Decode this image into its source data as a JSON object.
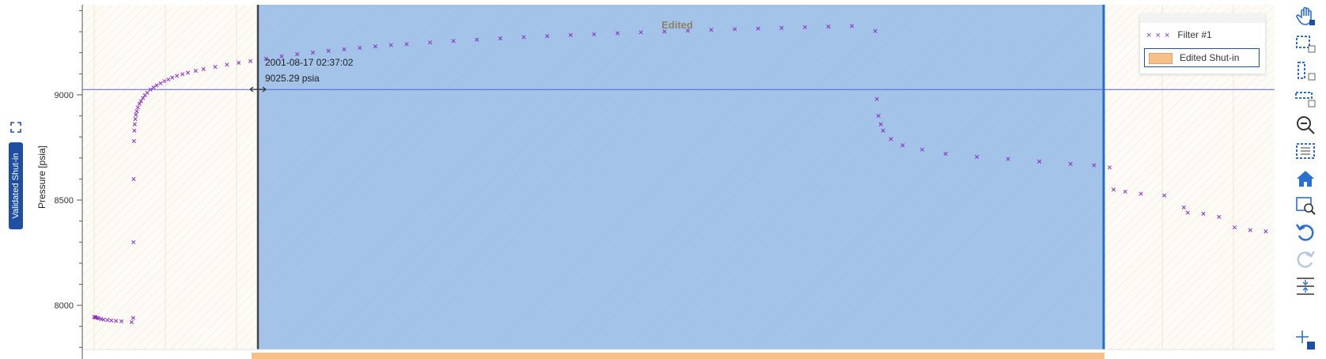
{
  "side_tab": {
    "label": "Validated Shut-in"
  },
  "legend": {
    "filter_label": "Filter #1",
    "shutin_label": "Edited Shut-in"
  },
  "region_label": "Edited",
  "tooltip": {
    "time": "2001-08-17 02:37:02",
    "value": "9025.29 psia"
  },
  "colors": {
    "edited_fill": "#a3c3e9",
    "marker": "#8b2fc0",
    "accent": "#1f4fa3",
    "shutin_bar": "#f7c08a"
  },
  "chart_data": {
    "type": "scatter",
    "ylabel": "Pressure [psia]",
    "y_ticks": [
      8000,
      8500,
      9000
    ],
    "ylim": [
      7790,
      9428
    ],
    "crosshair_y": 9025.29,
    "series": [
      {
        "name": "Filter #1",
        "x": [
          0.0,
          0.01,
          0.02,
          0.04,
          0.06,
          0.09,
          0.12,
          0.17,
          0.22,
          0.28,
          0.35,
          0.48,
          0.5,
          0.503,
          0.506,
          0.51,
          0.515,
          0.52,
          0.527,
          0.535,
          0.545,
          0.56,
          0.58,
          0.6,
          0.625,
          0.65,
          0.68,
          0.72,
          0.76,
          0.8,
          0.85,
          0.9,
          0.95,
          1.0,
          1.06,
          1.13,
          1.2,
          1.3,
          1.4,
          1.55,
          1.7,
          1.85,
          2.0,
          2.2,
          2.4,
          2.6,
          2.8,
          3.0,
          3.2,
          3.4,
          3.6,
          3.8,
          4.0,
          4.3,
          4.6,
          4.9,
          5.2,
          5.5,
          5.8,
          6.1,
          6.4,
          6.7,
          7.0,
          7.3,
          7.6,
          7.9,
          8.2,
          8.5,
          8.8,
          9.1,
          9.4,
          9.7,
          10.0,
          10.02,
          10.04,
          10.07,
          10.1,
          10.2,
          10.35,
          10.6,
          10.9,
          11.3,
          11.7,
          12.1,
          12.5,
          12.8,
          13.0,
          13.05,
          13.2,
          13.4,
          13.7,
          13.95,
          14.0,
          14.2,
          14.4,
          14.6,
          14.8,
          15.0
        ],
        "y": [
          7945,
          7944,
          7942,
          7940,
          7938,
          7935,
          7932,
          7930,
          7928,
          7926,
          7924,
          7920,
          7940,
          8300,
          8600,
          8780,
          8830,
          8860,
          8885,
          8905,
          8922,
          8940,
          8957,
          8970,
          8985,
          8998,
          9010,
          9025,
          9035,
          9045,
          9055,
          9065,
          9073,
          9082,
          9090,
          9098,
          9105,
          9114,
          9122,
          9133,
          9143,
          9152,
          9160,
          9172,
          9183,
          9193,
          9201,
          9209,
          9216,
          9223,
          9230,
          9236,
          9241,
          9249,
          9256,
          9262,
          9268,
          9274,
          9279,
          9284,
          9288,
          9293,
          9297,
          9301,
          9305,
          9309,
          9312,
          9315,
          9318,
          9321,
          9324,
          9327,
          9303,
          8980,
          8900,
          8860,
          8830,
          8790,
          8760,
          8740,
          8720,
          8705,
          8695,
          8683,
          8672,
          8665,
          8655,
          8550,
          8540,
          8530,
          8522,
          8465,
          8440,
          8435,
          8420,
          8370,
          8357,
          8351
        ]
      }
    ]
  }
}
